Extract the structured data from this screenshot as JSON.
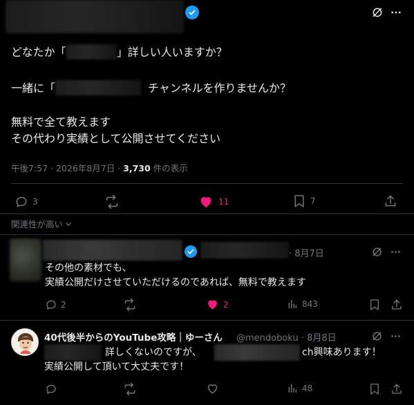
{
  "main_tweet": {
    "line1_pre": "どなたか「",
    "line1_post": "」詳しい人いますか？",
    "line2_pre": "一緒に「",
    "line2_post": "チャンネルを作りませんか？",
    "line3": "無料で全て教えます",
    "line4": "その代わり実績として公開させてください",
    "time": "午後7:57 · 2026年8月7日 · ",
    "views_count": "3,730",
    "views_label": " 件の表示",
    "replies": "3",
    "likes": "11",
    "bookmarks": "7"
  },
  "sort_label": "関連性が高い",
  "reply1": {
    "date": "· 8月7日",
    "line1": "その他の素材でも、",
    "line2": "実績公開だけさせていただけるのであれば、無料で教えます",
    "replies": "2",
    "likes": "2",
    "views": "843"
  },
  "reply2": {
    "name": "40代後半からのYouTube攻略｜ゆーさん",
    "handle": "@mendoboku",
    "date": "· 8月8日",
    "line1_mid": "詳しくないのですが、",
    "line1_end": "ch興味あります！",
    "line2": "実績公開して頂いて大丈夫です！",
    "views": "48"
  },
  "colors": {
    "like": "#f91880",
    "verified": "#1d9bf0",
    "muted": "#71767b",
    "divider": "#2f3336"
  }
}
